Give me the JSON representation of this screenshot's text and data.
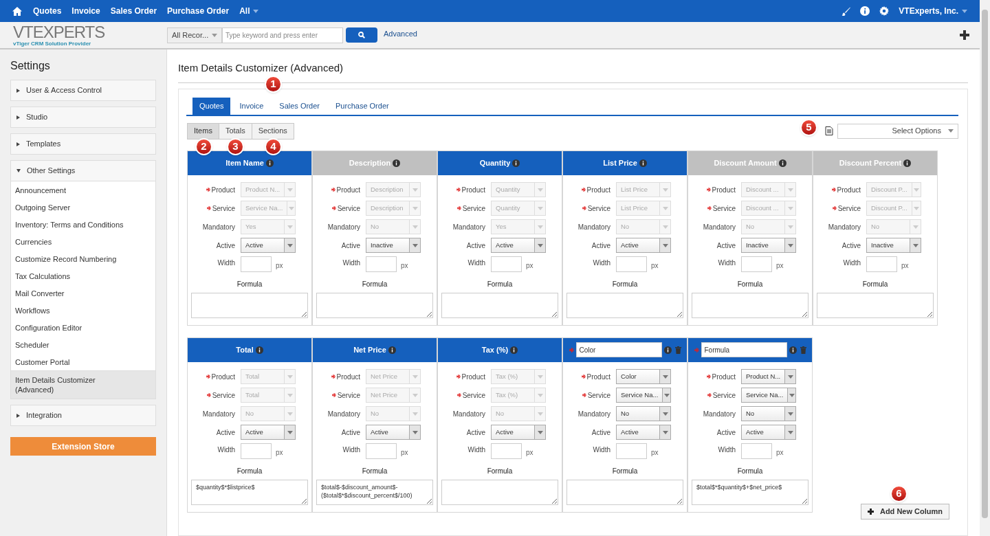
{
  "top_nav": {
    "items": [
      "Quotes",
      "Invoice",
      "Sales Order",
      "Purchase Order",
      "All"
    ],
    "user": "VTExperts, Inc."
  },
  "logo": {
    "name": "VTEXPERTS",
    "tagline": "vTiger CRM Solution Provider"
  },
  "search": {
    "scope": "All Recor...",
    "placeholder": "Type keyword and press enter",
    "advanced": "Advanced"
  },
  "sidebar": {
    "title": "Settings",
    "sections": [
      {
        "label": "User & Access Control",
        "expanded": false
      },
      {
        "label": "Studio",
        "expanded": false
      },
      {
        "label": "Templates",
        "expanded": false
      },
      {
        "label": "Other Settings",
        "expanded": true,
        "items": [
          {
            "label": "Announcement",
            "selected": false
          },
          {
            "label": "Outgoing Server",
            "selected": false
          },
          {
            "label": "Inventory: Terms and Conditions",
            "selected": false
          },
          {
            "label": "Currencies",
            "selected": false
          },
          {
            "label": "Customize Record Numbering",
            "selected": false
          },
          {
            "label": "Tax Calculations",
            "selected": false
          },
          {
            "label": "Mail Converter",
            "selected": false
          },
          {
            "label": "Workflows",
            "selected": false
          },
          {
            "label": "Configuration Editor",
            "selected": false
          },
          {
            "label": "Scheduler",
            "selected": false
          },
          {
            "label": "Customer Portal",
            "selected": false
          },
          {
            "label": "Item Details Customizer (Advanced)",
            "selected": true
          }
        ]
      },
      {
        "label": "Integration",
        "expanded": false
      }
    ],
    "extension_store": "Extension Store"
  },
  "page_title": "Item Details Customizer (Advanced)",
  "module_tabs": [
    {
      "label": "Quotes",
      "selected": true
    },
    {
      "label": "Invoice",
      "selected": false
    },
    {
      "label": "Sales Order",
      "selected": false
    },
    {
      "label": "Purchase Order",
      "selected": false
    }
  ],
  "sub_tabs": [
    {
      "label": "Items",
      "selected": true
    },
    {
      "label": "Totals",
      "selected": false
    },
    {
      "label": "Sections",
      "selected": false
    }
  ],
  "select_options": "Select Options",
  "columns": [
    {
      "kind": "standard",
      "title": "Item Name",
      "active": true,
      "selects": [
        {
          "label": "Product",
          "required": true,
          "value": "Product N...",
          "disabled": true
        },
        {
          "label": "Service",
          "required": true,
          "value": "Service Na...",
          "disabled": true
        },
        {
          "label": "Mandatory",
          "required": false,
          "value": "Yes",
          "disabled": true
        },
        {
          "label": "Active",
          "required": false,
          "value": "Active",
          "disabled": false
        }
      ],
      "width_label": "Width",
      "unit": "px",
      "formula_label": "Formula"
    },
    {
      "kind": "standard",
      "title": "Description",
      "active": false,
      "selects": [
        {
          "label": "Product",
          "required": true,
          "value": "Description",
          "disabled": true
        },
        {
          "label": "Service",
          "required": true,
          "value": "Description",
          "disabled": true
        },
        {
          "label": "Mandatory",
          "required": false,
          "value": "No",
          "disabled": true
        },
        {
          "label": "Active",
          "required": false,
          "value": "Inactive",
          "disabled": false
        }
      ],
      "width_label": "Width",
      "unit": "px",
      "formula_label": "Formula"
    },
    {
      "kind": "standard",
      "title": "Quantity",
      "active": true,
      "selects": [
        {
          "label": "Product",
          "required": true,
          "value": "Quantity",
          "disabled": true
        },
        {
          "label": "Service",
          "required": true,
          "value": "Quantity",
          "disabled": true
        },
        {
          "label": "Mandatory",
          "required": false,
          "value": "Yes",
          "disabled": true
        },
        {
          "label": "Active",
          "required": false,
          "value": "Active",
          "disabled": false
        }
      ],
      "width_label": "Width",
      "unit": "px",
      "formula_label": "Formula"
    },
    {
      "kind": "standard",
      "title": "List Price",
      "active": true,
      "selects": [
        {
          "label": "Product",
          "required": true,
          "value": "List Price",
          "disabled": true
        },
        {
          "label": "Service",
          "required": true,
          "value": "List Price",
          "disabled": true
        },
        {
          "label": "Mandatory",
          "required": false,
          "value": "No",
          "disabled": true
        },
        {
          "label": "Active",
          "required": false,
          "value": "Active",
          "disabled": false
        }
      ],
      "width_label": "Width",
      "unit": "px",
      "formula_label": "Formula"
    },
    {
      "kind": "standard",
      "title": "Discount Amount",
      "active": false,
      "selects": [
        {
          "label": "Product",
          "required": true,
          "value": "Discount ...",
          "disabled": true
        },
        {
          "label": "Service",
          "required": true,
          "value": "Discount ...",
          "disabled": true
        },
        {
          "label": "Mandatory",
          "required": false,
          "value": "No",
          "disabled": true
        },
        {
          "label": "Active",
          "required": false,
          "value": "Inactive",
          "disabled": false
        }
      ],
      "width_label": "Width",
      "unit": "px",
      "formula_label": "Formula"
    },
    {
      "kind": "standard",
      "title": "Discount Percent",
      "active": false,
      "selects": [
        {
          "label": "Product",
          "required": true,
          "value": "Discount P...",
          "disabled": true
        },
        {
          "label": "Service",
          "required": true,
          "value": "Discount P...",
          "disabled": true
        },
        {
          "label": "Mandatory",
          "required": false,
          "value": "No",
          "disabled": true
        },
        {
          "label": "Active",
          "required": false,
          "value": "Inactive",
          "disabled": false
        }
      ],
      "width_label": "Width",
      "unit": "px",
      "formula_label": "Formula"
    },
    {
      "kind": "standard",
      "title": "Total",
      "active": true,
      "selects": [
        {
          "label": "Product",
          "required": true,
          "value": "Total",
          "disabled": true
        },
        {
          "label": "Service",
          "required": true,
          "value": "Total",
          "disabled": true
        },
        {
          "label": "Mandatory",
          "required": false,
          "value": "No",
          "disabled": true
        },
        {
          "label": "Active",
          "required": false,
          "value": "Active",
          "disabled": false
        }
      ],
      "width_label": "Width",
      "unit": "px",
      "formula_label": "Formula",
      "formula": "$quantity$*$listprice$"
    },
    {
      "kind": "standard",
      "title": "Net Price",
      "active": true,
      "selects": [
        {
          "label": "Product",
          "required": true,
          "value": "Net Price",
          "disabled": true
        },
        {
          "label": "Service",
          "required": true,
          "value": "Net Price",
          "disabled": true
        },
        {
          "label": "Mandatory",
          "required": false,
          "value": "No",
          "disabled": true
        },
        {
          "label": "Active",
          "required": false,
          "value": "Active",
          "disabled": false
        }
      ],
      "width_label": "Width",
      "unit": "px",
      "formula_label": "Formula",
      "formula": "$total$-$discount_amount$-($total$*$discount_percent$/100)"
    },
    {
      "kind": "standard",
      "title": "Tax (%)",
      "active": true,
      "selects": [
        {
          "label": "Product",
          "required": true,
          "value": "Tax (%)",
          "disabled": true
        },
        {
          "label": "Service",
          "required": true,
          "value": "Tax (%)",
          "disabled": true
        },
        {
          "label": "Mandatory",
          "required": false,
          "value": "No",
          "disabled": true
        },
        {
          "label": "Active",
          "required": false,
          "value": "Active",
          "disabled": false
        }
      ],
      "width_label": "Width",
      "unit": "px",
      "formula_label": "Formula"
    },
    {
      "kind": "custom",
      "title": "Color",
      "active": true,
      "selects": [
        {
          "label": "Product",
          "required": true,
          "value": "Color",
          "disabled": false
        },
        {
          "label": "Service",
          "required": true,
          "value": "Service Na...",
          "disabled": false
        },
        {
          "label": "Mandatory",
          "required": false,
          "value": "No",
          "disabled": false
        },
        {
          "label": "Active",
          "required": false,
          "value": "Active",
          "disabled": false
        }
      ],
      "width_label": "Width",
      "unit": "px",
      "formula_label": "Formula"
    },
    {
      "kind": "custom",
      "title": "Formula",
      "active": true,
      "selects": [
        {
          "label": "Product",
          "required": true,
          "value": "Product N...",
          "disabled": false
        },
        {
          "label": "Service",
          "required": true,
          "value": "Service Na...",
          "disabled": false
        },
        {
          "label": "Mandatory",
          "required": false,
          "value": "No",
          "disabled": false
        },
        {
          "label": "Active",
          "required": false,
          "value": "Active",
          "disabled": false
        }
      ],
      "width_label": "Width",
      "unit": "px",
      "formula_label": "Formula",
      "formula": "$total$*$quantity$+$net_price$"
    }
  ],
  "add_column": "Add New Column",
  "callouts": [
    "1",
    "2",
    "3",
    "4",
    "5",
    "6"
  ]
}
